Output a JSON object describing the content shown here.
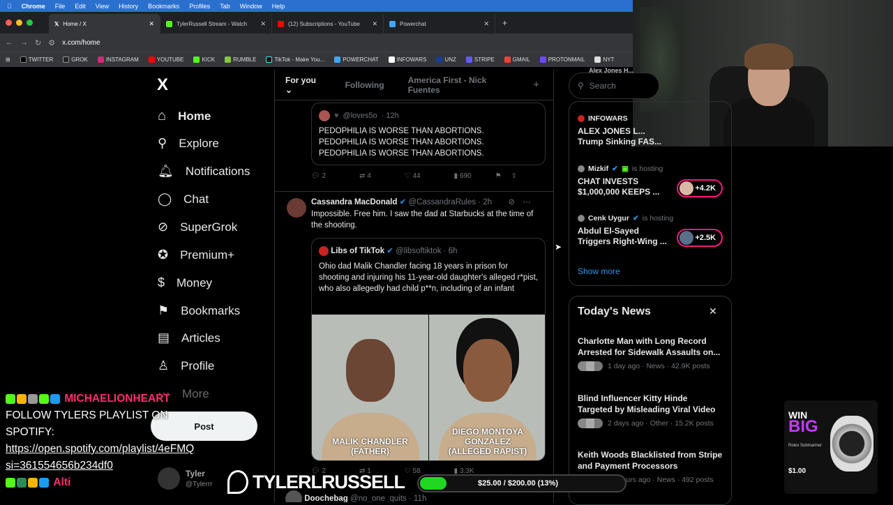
{
  "macmenu": [
    "Chrome",
    "File",
    "Edit",
    "View",
    "History",
    "Bookmarks",
    "Profiles",
    "Tab",
    "Window",
    "Help"
  ],
  "tabs": [
    {
      "label": "Home / X",
      "color": "#000"
    },
    {
      "label": "TylerRussell Stream - Watch",
      "color": "#53fc18"
    },
    {
      "label": "(12) Subscriptions - YouTube",
      "color": "#ff0000"
    },
    {
      "label": "Powerchat",
      "color": "#3fa7ff"
    }
  ],
  "address": "x.com/home",
  "bookmarks": [
    "TWITTER",
    "GROK",
    "INSTAGRAM",
    "YOUTUBE",
    "KICK",
    "RUMBLE",
    "TikTok - Make You...",
    "POWERCHAT",
    "INFOWARS",
    "UNZ",
    "STRIPE",
    "GMAIL",
    "PROTONMAIL",
    "NYT"
  ],
  "nav": {
    "logo": "X",
    "items": [
      "Home",
      "Explore",
      "Notifications",
      "Chat",
      "SuperGrok",
      "Premium+",
      "Money",
      "Bookmarks",
      "Articles",
      "Profile",
      "More"
    ],
    "post": "Post",
    "account_name": "Tyler",
    "account_handle": "@Tylerrr"
  },
  "feed": {
    "tabs": [
      "For you",
      "Following",
      "America First - Nick Fuentes"
    ],
    "plus": "+",
    "quote1": {
      "handle": "@loves5o",
      "time": "· 12h",
      "text": "PEDOPHILIA IS WORSE THAN ABORTIONS.\nPEDOPHILIA IS WORSE THAN ABORTIONS.\nPEDOPHILIA IS WORSE THAN ABORTIONS."
    },
    "actions1": {
      "replies": "2",
      "reposts": "4",
      "likes": "44",
      "views": "690"
    },
    "tweet2": {
      "name": "Cassandra MacDonald",
      "handle": "@CassandraRules",
      "time": "· 2h",
      "text": "Impossible. Free him. I saw the dad at Starbucks at the time of the shooting."
    },
    "quote2": {
      "name": "Libs of TikTok",
      "handle": "@libsoftiktok",
      "time": "· 6h",
      "text": "Ohio dad Malik Chandler facing 18 years in prison for shooting and injuring his 11-year-old daughter's alleged r*pist, who also allegedly had child p**n, including of an infant",
      "img_left": "MALIK CHANDLER\n(FATHER)",
      "img_right": "DIEGO MONTOYA GONZALEZ\n(ALLEGED RAPIST)"
    },
    "actions2": {
      "replies": "2",
      "reposts": "1",
      "likes": "58",
      "views": "3.3K"
    },
    "next": {
      "name": "Doochebag",
      "handle": "@no_one_quits",
      "time": "· 11h"
    }
  },
  "right": {
    "search": "Search",
    "partial_top": "Alex Jones H...",
    "live": [
      {
        "host": "INFOWARS",
        "status": "",
        "title": "ALEX JONES L... Trump Sinking FAS...",
        "count": ""
      },
      {
        "host": "Mizkif",
        "status": "is hosting",
        "title": "CHAT INVESTS $1,000,000 KEEPS ...",
        "count": "+4.2K"
      },
      {
        "host": "Cenk Uygur",
        "status": "is hosting",
        "title": "Abdul El-Sayed Triggers Right-Wing ...",
        "count": "+2.5K"
      }
    ],
    "show_more": "Show more",
    "news_title": "Today's News",
    "news": [
      {
        "headline": "Charlotte Man with Long Record Arrested for Sidewalk Assaults on...",
        "meta": "1 day ago · News · 42.9K posts"
      },
      {
        "headline": "Blind Influencer Kitty Hinde Targeted by Misleading Viral Video",
        "meta": "2 days ago · Other · 15.2K posts"
      },
      {
        "headline": "Keith Woods Blacklisted from Stripe and Payment Processors",
        "meta": "22 hours ago · News · 492 posts"
      }
    ]
  },
  "overlay": {
    "chat_user": "MICHAELIONHEART",
    "chat_lines": [
      "FOLLOW TYLERS PLAYLIST ON SPOTIFY:"
    ],
    "link": "https://open.spotify.com/playlist/4eFMQ si=361554656b234df0",
    "chat_user2": "Alti",
    "brand": "TYLERLRUSSELL",
    "goal": "$25.00 / $200.00 (13%)",
    "goal_fraction": 0.13,
    "ad_win": "WIN",
    "ad_big": "BIG",
    "ad_sub": "Rolex Submariner",
    "ad_price": "$1.00"
  }
}
